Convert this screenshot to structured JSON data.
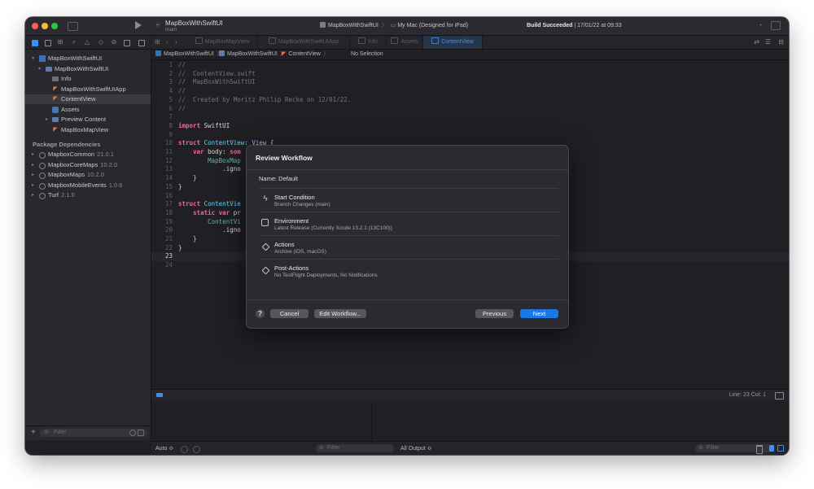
{
  "titlebar": {
    "project": "MapBoxWithSwiftUI",
    "branch": "main",
    "scheme": "MapBoxWithSwiftUI",
    "destination": "My Mac (Designed for iPad)",
    "status_bold": "Build Succeeded",
    "status_rest": " | 17/01/22 at 09:33"
  },
  "sidebar": {
    "items": [
      {
        "label": "MapBoxWithSwiftUI"
      },
      {
        "label": "MapBoxWithSwiftUI"
      },
      {
        "label": "Info"
      },
      {
        "label": "MapBoxWithSwiftUIApp"
      },
      {
        "label": "ContentView"
      },
      {
        "label": "Assets"
      },
      {
        "label": "Preview Content"
      },
      {
        "label": "MapBoxMapView"
      }
    ],
    "section_title": "Package Dependencies",
    "packages": [
      {
        "name": "MapboxCommon",
        "version": "21.0.1"
      },
      {
        "name": "MapboxCoreMaps",
        "version": "10.2.0"
      },
      {
        "name": "MapboxMaps",
        "version": "10.2.0"
      },
      {
        "name": "MapboxMobileEvents",
        "version": "1.0.6"
      },
      {
        "name": "Turf",
        "version": "2.1.0"
      }
    ],
    "filter_placeholder": "Filter"
  },
  "tabs": [
    {
      "label": "MapBoxMapView"
    },
    {
      "label": "MapBoxWithSwiftUIApp"
    },
    {
      "label": "Info"
    },
    {
      "label": "Assets"
    },
    {
      "label": "ContentView"
    }
  ],
  "jumpbar": {
    "project": "MapBoxWithSwiftUI",
    "group": "MapBoxWithSwiftUI",
    "file": "ContentView",
    "selection": "No Selection"
  },
  "code": {
    "line_numbers": [
      "1",
      "2",
      "3",
      "4",
      "5",
      "6",
      "7",
      "8",
      "9",
      "10",
      "11",
      "12",
      "13",
      "14",
      "15",
      "16",
      "17",
      "18",
      "19",
      "20",
      "21",
      "22",
      "23",
      "24"
    ],
    "current_line_index": 22,
    "lines": [
      [
        {
          "c": "c-cm",
          "t": "//"
        }
      ],
      [
        {
          "c": "c-cm",
          "t": "//  ContentView.swift"
        }
      ],
      [
        {
          "c": "c-cm",
          "t": "//  MapBoxWithSwiftUI"
        }
      ],
      [
        {
          "c": "c-cm",
          "t": "//"
        }
      ],
      [
        {
          "c": "c-cm",
          "t": "//  Created by Moritz Philip Recke on 12/01/22."
        }
      ],
      [
        {
          "c": "c-cm",
          "t": "//"
        }
      ],
      [],
      [
        {
          "c": "c-kw",
          "t": "import"
        },
        {
          "c": "c-tx",
          "t": " SwiftUI"
        }
      ],
      [],
      [
        {
          "c": "c-kw",
          "t": "struct"
        },
        {
          "c": "c-ty",
          "t": " ContentView"
        },
        {
          "c": "c-tx",
          "t": ": "
        },
        {
          "c": "c-pr",
          "t": "View"
        },
        {
          "c": "c-tx",
          "t": " {"
        }
      ],
      [
        {
          "c": "c-tx",
          "t": "    "
        },
        {
          "c": "c-kw",
          "t": "var"
        },
        {
          "c": "c-tx",
          "t": " body: "
        },
        {
          "c": "c-kw",
          "t": "som"
        }
      ],
      [
        {
          "c": "c-tx",
          "t": "        "
        },
        {
          "c": "c-fn",
          "t": "MapBoxMap"
        }
      ],
      [
        {
          "c": "c-tx",
          "t": "            .igno"
        }
      ],
      [
        {
          "c": "c-tx",
          "t": "    }"
        }
      ],
      [
        {
          "c": "c-tx",
          "t": "}"
        }
      ],
      [],
      [
        {
          "c": "c-kw",
          "t": "struct"
        },
        {
          "c": "c-ty",
          "t": " ContentVie"
        }
      ],
      [
        {
          "c": "c-tx",
          "t": "    "
        },
        {
          "c": "c-kw",
          "t": "static var"
        },
        {
          "c": "c-tx",
          "t": " pr"
        }
      ],
      [
        {
          "c": "c-tx",
          "t": "        "
        },
        {
          "c": "c-fn",
          "t": "ContentVi"
        }
      ],
      [
        {
          "c": "c-tx",
          "t": "            .igno"
        }
      ],
      [
        {
          "c": "c-tx",
          "t": "    }"
        }
      ],
      [
        {
          "c": "c-tx",
          "t": "}"
        }
      ],
      [],
      []
    ]
  },
  "debug": {
    "position": "Line: 23  Col: 1",
    "auto_label": "Auto ≎",
    "filter_placeholder": "Filter",
    "output_label": "All Output ≎",
    "console_filter_placeholder": "Filter"
  },
  "sheet": {
    "title": "Review Workflow",
    "name": "Name: Default",
    "steps": [
      {
        "icon": "bolt-icon",
        "title": "Start Condition",
        "subtitle": "Branch Changes (main)"
      },
      {
        "icon": "server-icon",
        "title": "Environment",
        "subtitle": "Latest Release (Currently Xcode 13.2.1 (13C100))"
      },
      {
        "icon": "hammer-icon",
        "title": "Actions",
        "subtitle": "Archive (iOS, macOS)"
      },
      {
        "icon": "arrow-diamond-icon",
        "title": "Post-Actions",
        "subtitle": "No TestFlight Deployments, No Notifications"
      }
    ],
    "help_label": "?",
    "cancel_label": "Cancel",
    "edit_label": "Edit Workflow...",
    "previous_label": "Previous",
    "next_label": "Next"
  },
  "colors": {
    "accent": "#1a78e6",
    "keyword": "#fc5fa3",
    "type": "#5dd8ff",
    "comment": "#6c7986"
  }
}
